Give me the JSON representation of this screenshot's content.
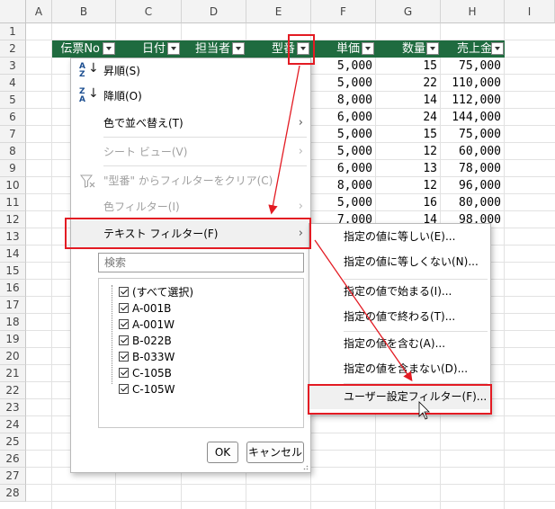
{
  "columns": [
    "A",
    "B",
    "C",
    "D",
    "E",
    "F",
    "G",
    "H",
    "I"
  ],
  "rows": [
    "1",
    "2",
    "3",
    "4",
    "5",
    "6",
    "7",
    "8",
    "9",
    "10",
    "11",
    "12",
    "13",
    "14",
    "15",
    "16",
    "17",
    "18",
    "19",
    "20",
    "21",
    "22",
    "23",
    "24",
    "25",
    "26",
    "27",
    "28"
  ],
  "table_headers": [
    "伝票No",
    "日付",
    "担当者",
    "型番",
    "単価",
    "数量",
    "売上金額"
  ],
  "table_headers_visible": [
    "伝票No",
    "日付",
    "担当者",
    "型番",
    "単価",
    "数量",
    "売上金"
  ],
  "unit_prices": [
    "5,000",
    "5,000",
    "8,000",
    "6,000",
    "5,000",
    "5,000",
    "6,000",
    "8,000",
    "5,000",
    "7,000"
  ],
  "quantities": [
    "15",
    "22",
    "14",
    "24",
    "15",
    "12",
    "13",
    "12",
    "16",
    "14"
  ],
  "sales": [
    "75,000",
    "110,000",
    "112,000",
    "144,000",
    "75,000",
    "60,000",
    "78,000",
    "96,000",
    "80,000",
    "98,000"
  ],
  "hidden_sales_right_col": [
    "",
    "",
    "",
    "",
    "",
    ""
  ],
  "filter_menu": {
    "sort_asc": "昇順(S)",
    "sort_desc": "降順(O)",
    "sort_by_color": "色で並べ替え(T)",
    "sheet_view": "シート ビュー(V)",
    "clear_filter": "\"型番\" からフィルターをクリア(C)",
    "color_filter": "色フィルター(I)",
    "text_filter": "テキスト フィルター(F)",
    "search_placeholder": "検索",
    "list_items": [
      "(すべて選択)",
      "A-001B",
      "A-001W",
      "B-022B",
      "B-033W",
      "C-105B",
      "C-105W"
    ],
    "ok": "OK",
    "cancel": "キャンセル"
  },
  "text_filter_submenu": [
    "指定の値に等しい(E)...",
    "指定の値に等しくない(N)...",
    "指定の値で始まる(I)...",
    "指定の値で終わる(T)...",
    "指定の値を含む(A)...",
    "指定の値を含まない(D)...",
    "ユーザー設定フィルター(F)..."
  ],
  "colors": {
    "header_green": "#1f6b3f",
    "highlight_red": "#e31b23"
  }
}
